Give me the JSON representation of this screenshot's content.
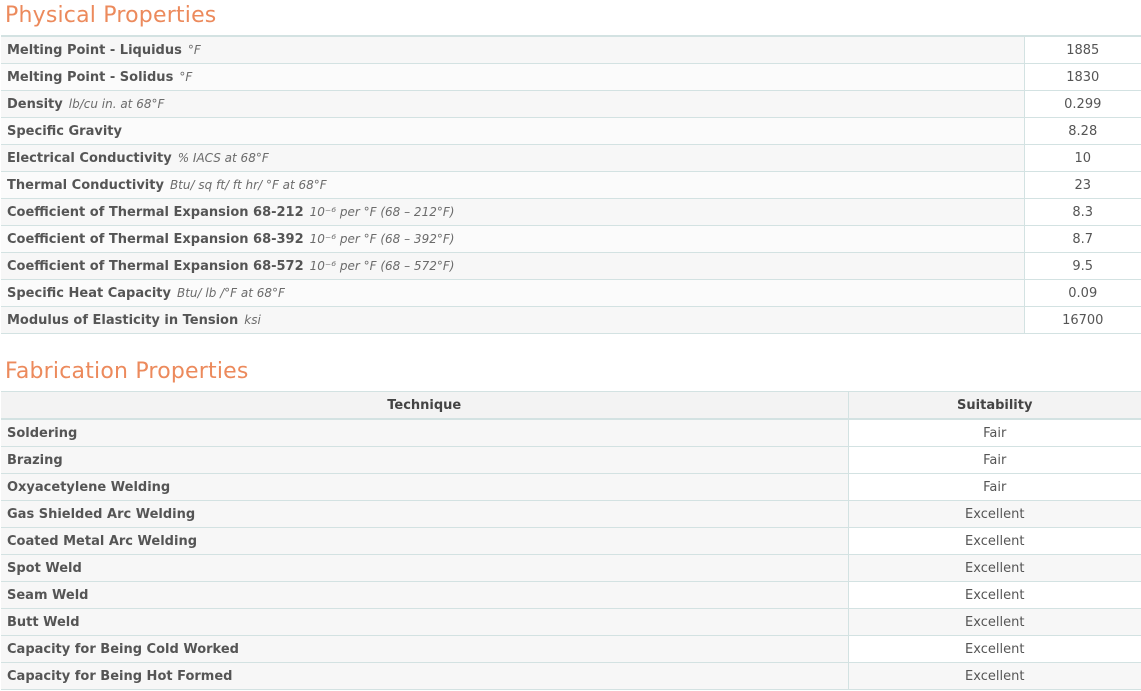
{
  "physical": {
    "title": "Physical Properties",
    "rows": [
      {
        "name": "Melting Point - Liquidus",
        "unit": "°F",
        "value": "1885"
      },
      {
        "name": "Melting Point - Solidus",
        "unit": "°F",
        "value": "1830"
      },
      {
        "name": "Density",
        "unit": "lb/cu in. at 68°F",
        "value": "0.299"
      },
      {
        "name": "Specific Gravity",
        "unit": "",
        "value": "8.28"
      },
      {
        "name": "Electrical Conductivity",
        "unit": "% IACS at 68°F",
        "value": "10"
      },
      {
        "name": "Thermal Conductivity",
        "unit": "Btu/ sq ft/ ft hr/ °F at 68°F",
        "value": "23"
      },
      {
        "name": "Coefficient of Thermal Expansion 68-212",
        "unit": "10⁻⁶ per °F (68 – 212°F)",
        "value": "8.3"
      },
      {
        "name": "Coefficient of Thermal Expansion 68-392",
        "unit": "10⁻⁶ per °F (68 – 392°F)",
        "value": "8.7"
      },
      {
        "name": "Coefficient of Thermal Expansion 68-572",
        "unit": "10⁻⁶ per °F (68 – 572°F)",
        "value": "9.5"
      },
      {
        "name": "Specific Heat Capacity",
        "unit": "Btu/ lb /°F at 68°F",
        "value": "0.09"
      },
      {
        "name": "Modulus of Elasticity in Tension",
        "unit": "ksi",
        "value": "16700"
      }
    ]
  },
  "fabrication": {
    "title": "Fabrication Properties",
    "headers": {
      "technique": "Technique",
      "suitability": "Suitability"
    },
    "rows": [
      {
        "technique": "Soldering",
        "suitability": "Fair"
      },
      {
        "technique": "Brazing",
        "suitability": "Fair"
      },
      {
        "technique": "Oxyacetylene Welding",
        "suitability": "Fair"
      },
      {
        "technique": "Gas Shielded Arc Welding",
        "suitability": "Excellent"
      },
      {
        "technique": "Coated Metal Arc Welding",
        "suitability": "Excellent"
      },
      {
        "technique": "Spot Weld",
        "suitability": "Excellent"
      },
      {
        "technique": "Seam Weld",
        "suitability": "Excellent"
      },
      {
        "technique": "Butt Weld",
        "suitability": "Excellent"
      },
      {
        "technique": "Capacity for Being Cold Worked",
        "suitability": "Excellent"
      },
      {
        "technique": "Capacity for Being Hot Formed",
        "suitability": "Excellent"
      }
    ]
  }
}
